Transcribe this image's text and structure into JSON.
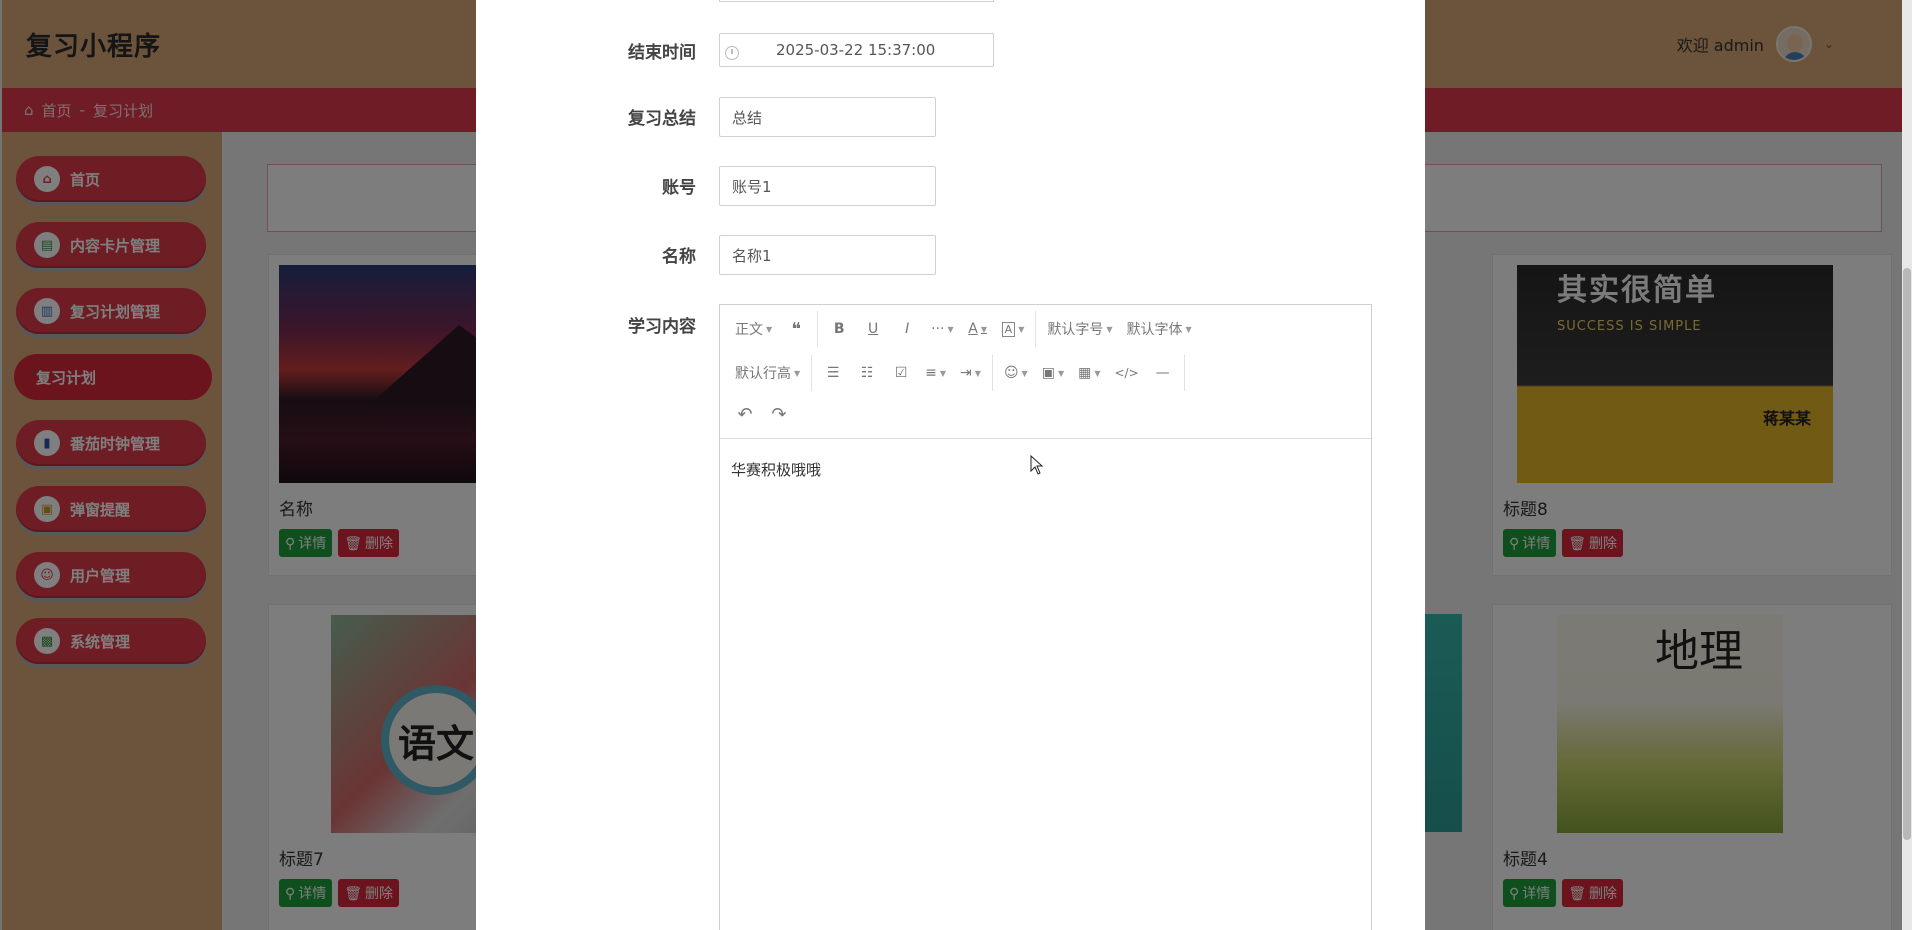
{
  "app": {
    "title": "复习小程序",
    "welcome": "欢迎 admin",
    "breadcrumb_home": "首页",
    "breadcrumb_sep": "-",
    "breadcrumb_current": "复习计划"
  },
  "sidebar": {
    "items": [
      {
        "label": "首页",
        "icon": "home-icon"
      },
      {
        "label": "内容卡片管理",
        "icon": "card-icon"
      },
      {
        "label": "复习计划管理",
        "icon": "plan-icon"
      },
      {
        "label": "复习计划",
        "icon": ""
      },
      {
        "label": "番茄时钟管理",
        "icon": "timer-icon"
      },
      {
        "label": "弹窗提醒",
        "icon": "popup-icon"
      },
      {
        "label": "用户管理",
        "icon": "user-icon"
      },
      {
        "label": "系统管理",
        "icon": "system-icon"
      }
    ]
  },
  "cards": [
    {
      "name": "名称",
      "detail": "详情",
      "delete": "删除"
    },
    {
      "name": "标题8",
      "detail": "详情",
      "delete": "删除"
    },
    {
      "name": "标题7",
      "detail": "详情",
      "delete": "删除"
    },
    {
      "name": "标题4",
      "detail": "详情",
      "delete": "删除"
    }
  ],
  "poster": {
    "title": "其实很简单",
    "subtitle": "SUCCESS IS SIMPLE",
    "badge": "蒋某某"
  },
  "book1": {
    "title": "语文"
  },
  "book2": {
    "title": "地理"
  },
  "form": {
    "end_time_label": "结束时间",
    "end_time_value": "2025-03-22 15:37:00",
    "summary_label": "复习总结",
    "summary_value": "总结",
    "account_label": "账号",
    "account_value": "账号1",
    "name_label": "名称",
    "name_value": "名称1",
    "content_label": "学习内容",
    "content_value": "华赛积极哦哦"
  },
  "editor_toolbar": {
    "row1": [
      "正文",
      "❝",
      "B",
      "U",
      "I",
      "···",
      "A",
      "A",
      "默认字号",
      "默认字体"
    ],
    "row2": [
      "默认行高",
      "☰",
      "☷",
      "☑",
      "≡",
      "⇥",
      "☺",
      "▣",
      "▦",
      "</>",
      "—"
    ],
    "row3": [
      "↶",
      "↷"
    ]
  },
  "colors": {
    "topbar": "#d9a777",
    "accent": "#de3a49",
    "success": "#1f9d3a"
  }
}
